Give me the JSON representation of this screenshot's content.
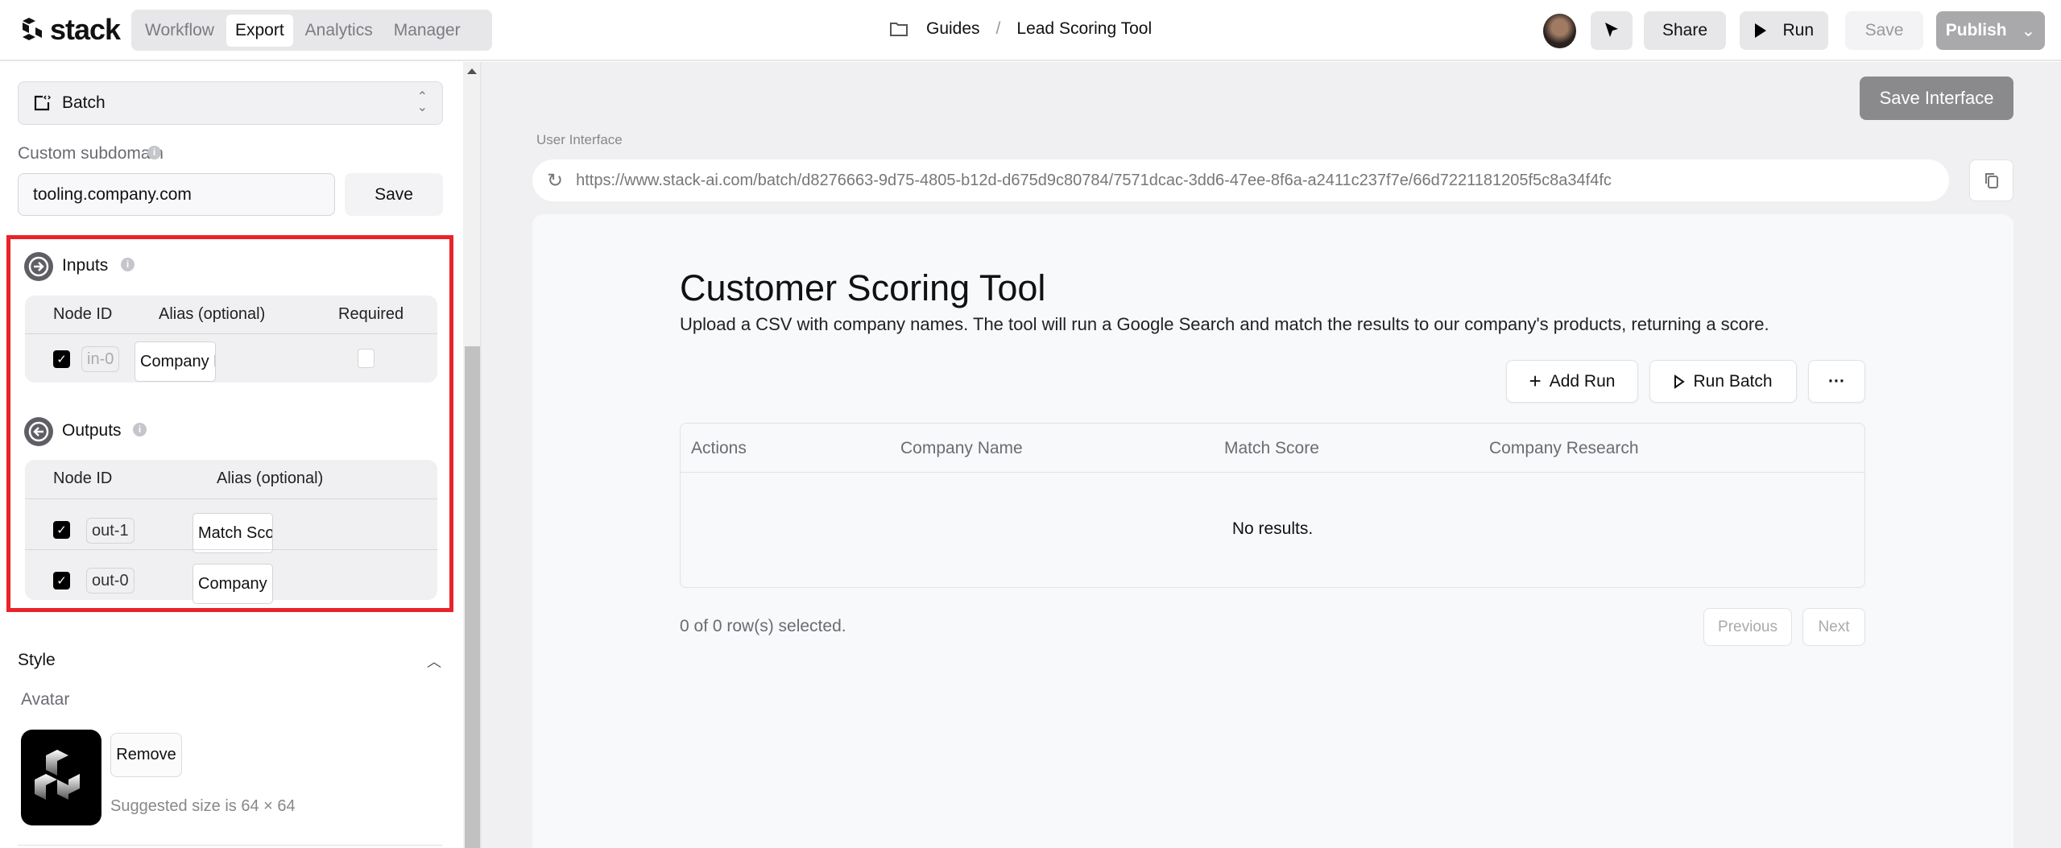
{
  "header": {
    "logo_text": "stack",
    "tabs": [
      {
        "label": "Workflow",
        "active": false
      },
      {
        "label": "Export",
        "active": true
      },
      {
        "label": "Analytics",
        "active": false
      },
      {
        "label": "Manager",
        "active": false
      }
    ],
    "breadcrumb": {
      "folder": "Guides",
      "separator": "/",
      "page": "Lead Scoring Tool"
    },
    "buttons": {
      "share": "Share",
      "run": "Run",
      "save": "Save",
      "publish": "Publish"
    }
  },
  "sidebar": {
    "mode_select": {
      "value": "Batch",
      "icon": "batch-icon"
    },
    "subdomain": {
      "label": "Custom subdomain",
      "value": "tooling.company.com",
      "save": "Save"
    },
    "inputs": {
      "title": "Inputs",
      "columns": [
        "Node ID",
        "Alias (optional)",
        "Required"
      ],
      "rows": [
        {
          "checked": true,
          "node_id": "in-0",
          "alias": "Company N",
          "required": false
        }
      ]
    },
    "outputs": {
      "title": "Outputs",
      "columns": [
        "Node ID",
        "Alias (optional)"
      ],
      "rows": [
        {
          "checked": true,
          "node_id": "out-1",
          "alias": "Match Scor"
        },
        {
          "checked": true,
          "node_id": "out-0",
          "alias": "Company R"
        }
      ]
    },
    "style": {
      "title": "Style",
      "avatar_label": "Avatar",
      "remove": "Remove",
      "hint": "Suggested size is 64 × 64"
    }
  },
  "main": {
    "save_interface": "Save Interface",
    "ui_label": "User Interface",
    "url": "https://www.stack-ai.com/batch/d8276663-9d75-4805-b12d-d675d9c80784/7571dcac-3dd6-47ee-8f6a-a2411c237f7e/66d7221181205f5c8a34f4fc",
    "tool": {
      "title": "Customer Scoring Tool",
      "description": "Upload a CSV with company names. The tool will run a Google Search and match the results to our company's products, returning a score.",
      "add_run": "Add Run",
      "run_batch": "Run Batch",
      "more": "···",
      "columns": [
        "Actions",
        "Company Name",
        "Match Score",
        "Company Research"
      ],
      "empty": "No results.",
      "selection": "0 of 0 row(s) selected.",
      "previous": "Previous",
      "next": "Next"
    }
  },
  "colors": {
    "highlight": "#e8232a",
    "publish_bg": "#a9a9ab",
    "save_interface_bg": "#8a8a8c"
  }
}
